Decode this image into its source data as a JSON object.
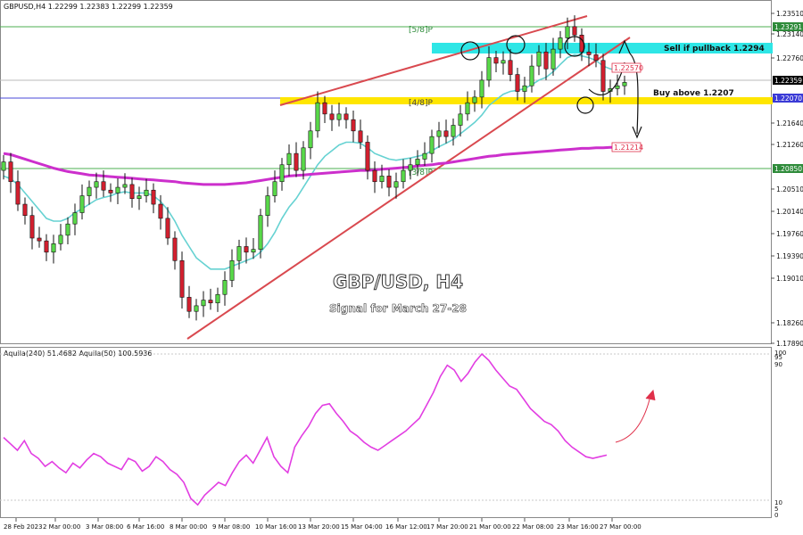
{
  "header": {
    "symbol_line": "GBPUSD,H4  1.22299 1.22383 1.22299 1.22359"
  },
  "overlay": {
    "title": "GBP/USD, H4",
    "subtitle": "Signal for March 27-28"
  },
  "annotations": {
    "sell_text": "Sell if pullback 1.2294",
    "buy_text": "Buy above 1.2207",
    "murray_5_8": "[5/8]P",
    "murray_4_8": "[4/8]P",
    "murray_3_8": "[3/8]P"
  },
  "price_axis": {
    "ticks": [
      "1.23510",
      "1.23140",
      "1.22760",
      "1.21640",
      "1.21260",
      "1.20510",
      "1.20140",
      "1.19760",
      "1.19390",
      "1.19010",
      "1.18260",
      "1.17890"
    ],
    "badges": [
      {
        "label": "1.23291",
        "color": "#2e8b3a"
      },
      {
        "label": "1.22359",
        "color": "#000000"
      },
      {
        "label": "1.22070",
        "color": "#3a3ad6"
      },
      {
        "label": "1.20850",
        "color": "#2e8b3a"
      }
    ],
    "inline_labels": [
      {
        "label": "1.22570",
        "color": "#e0304a"
      },
      {
        "label": "1.21214",
        "color": "#e0304a"
      }
    ]
  },
  "indicator": {
    "label": "Aquila(240) 51.4682  Aquila(50) 100.5936",
    "ticks": [
      "100",
      "95",
      "90",
      "10",
      "5",
      "0"
    ]
  },
  "time_axis": {
    "labels": [
      "28 Feb 2023",
      "2 Mar 00:00",
      "3 Mar 08:00",
      "6 Mar 16:00",
      "8 Mar 00:00",
      "9 Mar 08:00",
      "10 Mar 16:00",
      "13 Mar 20:00",
      "15 Mar 04:00",
      "16 Mar 12:00",
      "17 Mar 20:00",
      "21 Mar 00:00",
      "22 Mar 08:00",
      "23 Mar 16:00",
      "27 Mar 00:00"
    ]
  },
  "chart_data": {
    "type": "candlestick",
    "symbol": "GBPUSD",
    "timeframe": "H4",
    "ylim": [
      1.1775,
      1.236
    ],
    "x": [
      "28 Feb 2023",
      "2 Mar 00:00",
      "3 Mar 08:00",
      "6 Mar 16:00",
      "8 Mar 00:00",
      "9 Mar 08:00",
      "10 Mar 16:00",
      "13 Mar 20:00",
      "15 Mar 04:00",
      "16 Mar 12:00",
      "17 Mar 20:00",
      "21 Mar 00:00",
      "22 Mar 08:00",
      "23 Mar 16:00",
      "27 Mar 00:00"
    ],
    "close": [
      1.2095,
      1.206,
      1.202,
      1.2,
      1.196,
      1.1955,
      1.1935,
      1.195,
      1.1965,
      1.1985,
      1.2005,
      1.2035,
      1.205,
      1.206,
      1.2045,
      1.204,
      1.205,
      1.2055,
      1.203,
      1.2035,
      1.2045,
      1.202,
      1.1995,
      1.196,
      1.192,
      1.1855,
      1.183,
      1.184,
      1.185,
      1.1845,
      1.186,
      1.1885,
      1.192,
      1.1945,
      1.1935,
      1.194,
      1.2,
      1.2035,
      1.206,
      1.209,
      1.211,
      1.208,
      1.212,
      1.215,
      1.22,
      1.218,
      1.217,
      1.218,
      1.217,
      1.215,
      1.213,
      1.208,
      1.206,
      1.207,
      1.205,
      1.206,
      1.208,
      1.209,
      1.21,
      1.211,
      1.214,
      1.215,
      1.214,
      1.216,
      1.218,
      1.22,
      1.221,
      1.224,
      1.228,
      1.227,
      1.2275,
      1.225,
      1.222,
      1.223,
      1.2265,
      1.229,
      1.226,
      1.2295,
      1.2315,
      1.2335,
      1.232,
      1.229,
      1.2285,
      1.2275,
      1.222,
      1.2225,
      1.223,
      1.2236
    ],
    "series": [
      {
        "name": "",
        "color": "#66d2d2",
        "values": [
          1.207,
          1.2065,
          1.2055,
          1.204,
          1.2025,
          1.201,
          1.1995,
          1.199,
          1.199,
          1.1995,
          1.2005,
          1.2012,
          1.202,
          1.2028,
          1.2032,
          1.2035,
          1.204,
          1.2042,
          1.204,
          1.204,
          1.204,
          1.2035,
          1.2025,
          1.201,
          1.199,
          1.1965,
          1.1945,
          1.1925,
          1.1915,
          1.1905,
          1.1905,
          1.1905,
          1.191,
          1.1915,
          1.192,
          1.1925,
          1.1935,
          1.195,
          1.197,
          1.1995,
          1.2015,
          1.203,
          1.205,
          1.207,
          1.209,
          1.2105,
          1.2115,
          1.2125,
          1.213,
          1.213,
          1.2128,
          1.212,
          1.211,
          1.2105,
          1.21,
          1.2098,
          1.21,
          1.2102,
          1.2105,
          1.2108,
          1.2115,
          1.2122,
          1.2128,
          1.2135,
          1.2145,
          1.2155,
          1.2165,
          1.2178,
          1.2195,
          1.2205,
          1.2215,
          1.222,
          1.2222,
          1.2225,
          1.2232,
          1.224,
          1.2245,
          1.2255,
          1.2268,
          1.228,
          1.2285,
          1.2283,
          1.228,
          1.2275,
          1.2265,
          1.226,
          1.2257,
          1.2257
        ]
      },
      {
        "name": "",
        "color": "#cc2fcc",
        "values": [
          1.211,
          1.2108,
          1.2104,
          1.21,
          1.2096,
          1.2092,
          1.2088,
          1.2084,
          1.2081,
          1.2078,
          1.2076,
          1.2074,
          1.2072,
          1.2071,
          1.207,
          1.2069,
          1.2068,
          1.2067,
          1.2066,
          1.2065,
          1.2064,
          1.2063,
          1.2062,
          1.2061,
          1.206,
          1.2058,
          1.2057,
          1.2056,
          1.2055,
          1.2055,
          1.2055,
          1.2055,
          1.2056,
          1.2057,
          1.2058,
          1.206,
          1.2062,
          1.2064,
          1.2066,
          1.2068,
          1.207,
          1.2071,
          1.2072,
          1.2073,
          1.2074,
          1.2075,
          1.2076,
          1.2077,
          1.2078,
          1.2079,
          1.208,
          1.208,
          1.2081,
          1.2082,
          1.2083,
          1.2084,
          1.2085,
          1.2086,
          1.2088,
          1.2089,
          1.209,
          1.2092,
          1.2093,
          1.2095,
          1.2097,
          1.2099,
          1.2101,
          1.2103,
          1.2105,
          1.2106,
          1.2108,
          1.2109,
          1.211,
          1.2111,
          1.2112,
          1.2113,
          1.2114,
          1.2115,
          1.2116,
          1.2117,
          1.2118,
          1.2119,
          1.2119,
          1.212,
          1.212,
          1.2121,
          1.2121,
          1.2121
        ]
      }
    ],
    "oscillator": {
      "name": "Aquila(240) / Aquila(50)",
      "ylim": [
        0,
        100
      ],
      "values": [
        48,
        44,
        40,
        46,
        38,
        35,
        30,
        33,
        29,
        26,
        32,
        29,
        34,
        38,
        36,
        32,
        30,
        28,
        35,
        33,
        27,
        30,
        36,
        33,
        28,
        25,
        20,
        10,
        6,
        12,
        16,
        20,
        18,
        26,
        33,
        37,
        32,
        40,
        48,
        36,
        30,
        26,
        42,
        49,
        55,
        63,
        68,
        69,
        63,
        58,
        52,
        49,
        45,
        42,
        40,
        43,
        46,
        49,
        52,
        56,
        60,
        68,
        76,
        86,
        93,
        90,
        83,
        88,
        95,
        100,
        96,
        90,
        85,
        80,
        78,
        72,
        66,
        62,
        58,
        56,
        52,
        46,
        42,
        39,
        36,
        35,
        36,
        37
      ]
    }
  }
}
